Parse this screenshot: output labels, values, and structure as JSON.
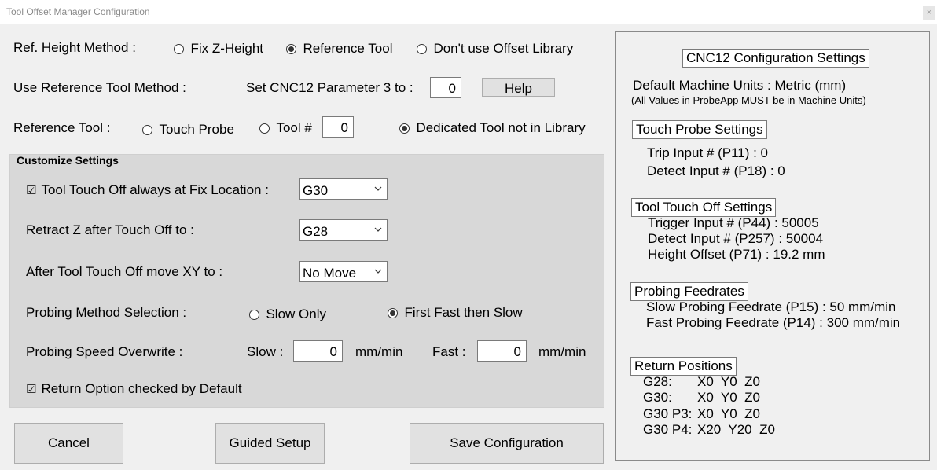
{
  "window": {
    "title": "Tool Offset Manager Configuration",
    "close_glyph": "×"
  },
  "ref_height": {
    "label": "Ref. Height Method :",
    "options": [
      "Fix Z-Height",
      "Reference Tool",
      "Don't use Offset Library"
    ],
    "selected": "Reference Tool"
  },
  "ref_tool_method": {
    "label": "Use Reference Tool Method :",
    "param_label": "Set CNC12 Parameter 3 to :",
    "param_value": "0",
    "help_label": "Help"
  },
  "reference_tool": {
    "label": "Reference Tool :",
    "touch_probe": "Touch Probe",
    "tool_num": "Tool #",
    "tool_num_value": "0",
    "dedicated": "Dedicated Tool not in Library",
    "selected": "Dedicated Tool not in Library"
  },
  "customize": {
    "title": "Customize Settings",
    "touch_off_fix_label": "Tool Touch Off always at Fix Location :",
    "touch_off_fix_checked": true,
    "touch_off_fix_value": "G30",
    "retract_label": "Retract Z after Touch Off to :",
    "retract_value": "G28",
    "after_move_label": "After Tool Touch Off move XY to :",
    "after_move_value": "No Move",
    "probing_method_label": "Probing Method Selection :",
    "slow_only": "Slow Only",
    "fast_then_slow": "First Fast then Slow",
    "probing_selected": "First Fast then Slow",
    "speed_overwrite_label": "Probing Speed Overwrite :",
    "slow_label": "Slow :",
    "slow_value": "0",
    "slow_unit": "mm/min",
    "fast_label": "Fast :",
    "fast_value": "0",
    "fast_unit": "mm/min",
    "return_option_label": "Return Option checked by Default",
    "return_option_checked": true
  },
  "buttons": {
    "cancel": "Cancel",
    "guided_setup": "Guided Setup",
    "save": "Save Configuration"
  },
  "cnc12": {
    "title": "CNC12 Configuration Settings",
    "units_line": "Default Machine Units : Metric (mm)",
    "units_note": "(All Values in ProbeApp MUST be in Machine Units)",
    "touch_probe_title": "Touch Probe Settings",
    "trip_input": "Trip Input # (P11) : 0",
    "detect_input": "Detect Input # (P18) : 0",
    "tool_touch_title": "Tool Touch Off Settings",
    "trigger_input": "Trigger Input # (P44) : 50005",
    "detect_input_257": "Detect Input # (P257) : 50004",
    "height_offset": "Height Offset (P71) : 19.2 mm",
    "feedrates_title": "Probing Feedrates",
    "slow_feed": "Slow Probing Feedrate (P15) : 50 mm/min",
    "fast_feed": "Fast Probing Feedrate (P14) : 300 mm/min",
    "return_title": "Return Positions",
    "return_rows": [
      {
        "name": "G28:",
        "value": "X0  Y0  Z0"
      },
      {
        "name": "G30:",
        "value": "X0  Y0  Z0"
      },
      {
        "name": "G30 P3:",
        "value": "X0  Y0  Z0"
      },
      {
        "name": "G30 P4:",
        "value": "X20  Y20  Z0"
      }
    ]
  },
  "icons": {
    "checkbox_mark": "☑",
    "chevron": "chevron-down-icon",
    "radio": "radio-button"
  }
}
